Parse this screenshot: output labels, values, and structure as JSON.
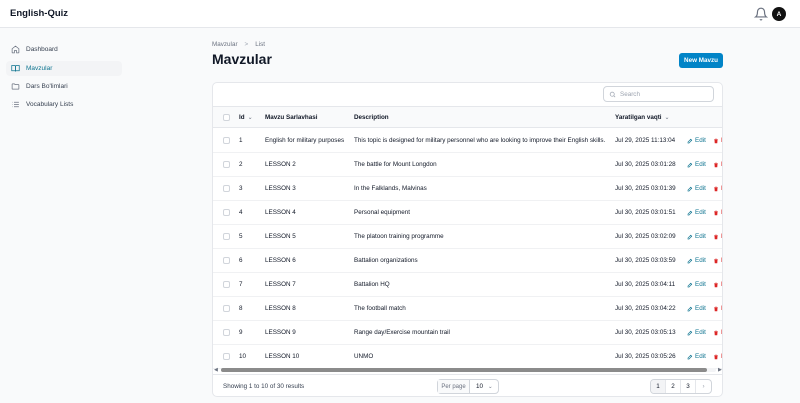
{
  "app": {
    "title": "English-Quiz",
    "avatar_letter": "A"
  },
  "sidebar": {
    "items": [
      {
        "label": "Dashboard",
        "icon": "home-icon"
      },
      {
        "label": "Mavzular",
        "icon": "book-icon",
        "active": true
      },
      {
        "label": "Dars Bo'limlari",
        "icon": "folder-icon"
      },
      {
        "label": "Vocabulary Lists",
        "icon": "list-icon"
      }
    ]
  },
  "breadcrumb": {
    "parent": "Mavzular",
    "separator": ">",
    "current": "List"
  },
  "page": {
    "title": "Mavzular",
    "new_button": "New Mavzu"
  },
  "search": {
    "placeholder": "Search"
  },
  "table": {
    "columns": [
      "Id",
      "Mavzu Sarlavhasi",
      "Description",
      "Yaratilgan vaqti"
    ],
    "action_edit": "Edit",
    "action_delete": "Delete",
    "rows": [
      {
        "id": "1",
        "title": "English for military purposes",
        "description": "This topic is designed for military personnel who are looking to improve their English skills.",
        "created": "Jul 29, 2025 11:13:04"
      },
      {
        "id": "2",
        "title": "LESSON 2",
        "description": "The battle for Mount Longdon",
        "created": "Jul 30, 2025 03:01:28"
      },
      {
        "id": "3",
        "title": "LESSON 3",
        "description": "In the Falklands, Malvinas",
        "created": "Jul 30, 2025 03:01:39"
      },
      {
        "id": "4",
        "title": "LESSON 4",
        "description": "Personal equipment",
        "created": "Jul 30, 2025 03:01:51"
      },
      {
        "id": "5",
        "title": "LESSON 5",
        "description": "The platoon training programme",
        "created": "Jul 30, 2025 03:02:09"
      },
      {
        "id": "6",
        "title": "LESSON 6",
        "description": "Battalion organizations",
        "created": "Jul 30, 2025 03:03:59"
      },
      {
        "id": "7",
        "title": "LESSON 7",
        "description": "Battalion HQ",
        "created": "Jul 30, 2025 03:04:11"
      },
      {
        "id": "8",
        "title": "LESSON 8",
        "description": "The football match",
        "created": "Jul 30, 2025 03:04:22"
      },
      {
        "id": "9",
        "title": "LESSON 9",
        "description": "Range day/Exercise mountain trail",
        "created": "Jul 30, 2025 03:05:13"
      },
      {
        "id": "10",
        "title": "LESSON 10",
        "description": "UNMO",
        "created": "Jul 30, 2025 03:05:26"
      }
    ]
  },
  "footer": {
    "showing": "Showing 1 to 10 of 30 results",
    "per_page_label": "Per page",
    "per_page_value": "10",
    "pages": [
      "1",
      "2",
      "3"
    ],
    "next": "›"
  },
  "colors": {
    "accent": "#0284c7",
    "active_nav": "#0e7490",
    "danger": "#dc2626"
  }
}
